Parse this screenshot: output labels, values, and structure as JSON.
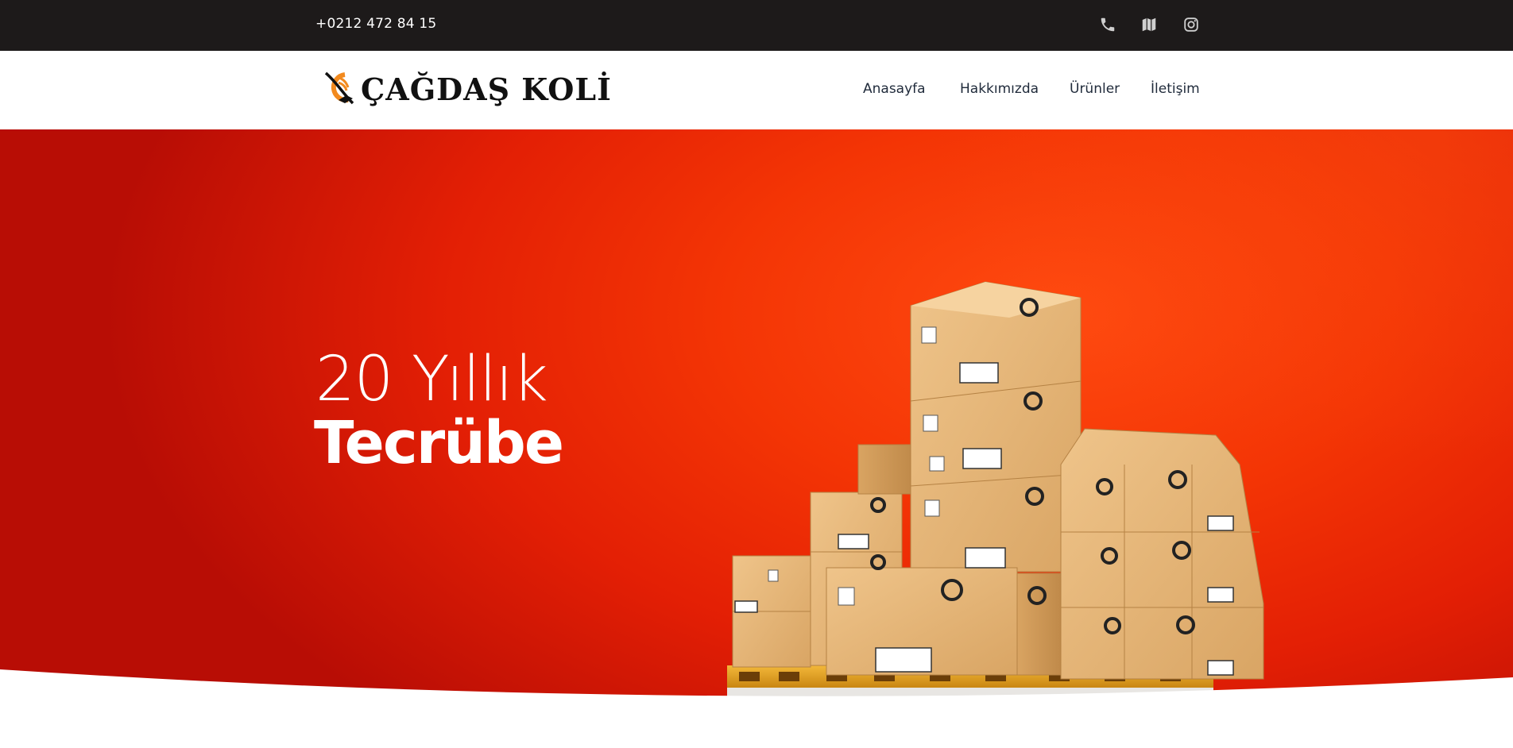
{
  "topbar": {
    "phone": "+0212 472 84 15",
    "social_icons": [
      "phone-icon",
      "map-icon",
      "instagram-icon"
    ]
  },
  "header": {
    "logo_text": "ÇAĞDAŞ KOLİ",
    "nav": [
      {
        "label": "Anasayfa"
      },
      {
        "label": "Hakkımızda"
      },
      {
        "label": "Ürünler"
      },
      {
        "label": "İletişim"
      }
    ]
  },
  "hero": {
    "line1": "20 Yıllık",
    "line2": "Tecrübe"
  },
  "colors": {
    "topbar_bg": "#1d1a1a",
    "hero_red": "#e31f05",
    "hero_orange": "#ff4a10",
    "nav_text": "#1f2a3a",
    "logo_accent": "#f28a1e"
  }
}
